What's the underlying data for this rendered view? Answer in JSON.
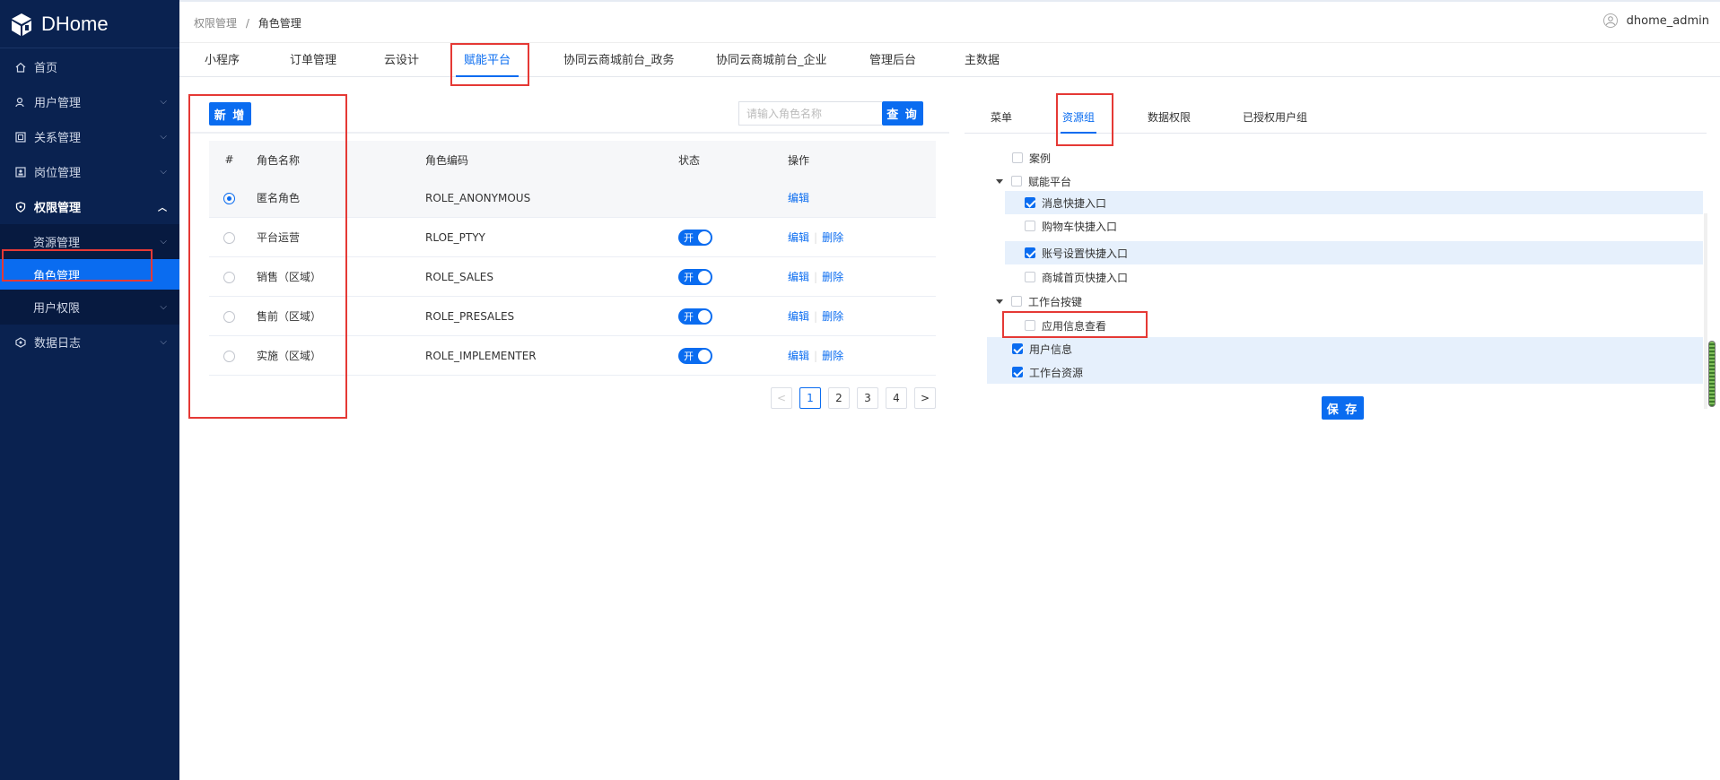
{
  "app": {
    "name": "DHome"
  },
  "sidebar": {
    "items": [
      {
        "label": "首页",
        "icon": "home-icon"
      },
      {
        "label": "用户管理",
        "icon": "user-icon"
      },
      {
        "label": "关系管理",
        "icon": "relation-icon"
      },
      {
        "label": "岗位管理",
        "icon": "post-icon"
      },
      {
        "label": "权限管理",
        "icon": "shield-icon"
      },
      {
        "label": "数据日志",
        "icon": "log-icon"
      }
    ],
    "sub": [
      {
        "label": "资源管理"
      },
      {
        "label": "角色管理"
      },
      {
        "label": "用户权限"
      }
    ]
  },
  "breadcrumb": {
    "parent": "权限管理",
    "sep": "/",
    "current": "角色管理"
  },
  "user": {
    "name": "dhome_admin"
  },
  "tabs": [
    "小程序",
    "订单管理",
    "云设计",
    "赋能平台",
    "协同云商城前台_政务",
    "协同云商城前台_企业",
    "管理后台",
    "主数据"
  ],
  "toolbar": {
    "add_label": "新 增",
    "search_placeholder": "请输入角色名称",
    "search_label": "查 询"
  },
  "table": {
    "headers": [
      "#",
      "角色名称",
      "角色编码",
      "状态",
      "操作"
    ],
    "rows": [
      {
        "name": "匿名角色",
        "code": "ROLE_ANONYMOUS",
        "selected": true,
        "status": "",
        "actions": [
          "编辑"
        ]
      },
      {
        "name": "平台运营",
        "code": "RLOE_PTYY",
        "selected": false,
        "status": "开",
        "actions": [
          "编辑",
          "删除"
        ]
      },
      {
        "name": "销售（区域）",
        "code": "ROLE_SALES",
        "selected": false,
        "status": "开",
        "actions": [
          "编辑",
          "删除"
        ]
      },
      {
        "name": "售前（区域）",
        "code": "ROLE_PRESALES",
        "selected": false,
        "status": "开",
        "actions": [
          "编辑",
          "删除"
        ]
      },
      {
        "name": "实施（区域）",
        "code": "ROLE_IMPLEMENTER",
        "selected": false,
        "status": "开",
        "actions": [
          "编辑",
          "删除"
        ]
      }
    ]
  },
  "pagination": {
    "prev": "<",
    "pages": [
      "1",
      "2",
      "3",
      "4"
    ],
    "current": "1",
    "next": ">"
  },
  "right_tabs": [
    "菜单",
    "资源组",
    "数据权限",
    "已授权用户组"
  ],
  "tree": [
    {
      "label": "案例",
      "checked": false
    },
    {
      "label": "赋能平台",
      "checked": false,
      "expanded": true
    },
    {
      "label": "消息快捷入口",
      "checked": true
    },
    {
      "label": "购物车快捷入口",
      "checked": false
    },
    {
      "label": "账号设置快捷入口",
      "checked": true
    },
    {
      "label": "商城首页快捷入口",
      "checked": false
    },
    {
      "label": "工作台按键",
      "checked": false,
      "expanded": true
    },
    {
      "label": "应用信息查看",
      "checked": false
    },
    {
      "label": "用户信息",
      "checked": true
    },
    {
      "label": "工作台资源",
      "checked": true
    }
  ],
  "save_label": "保 存",
  "colors": {
    "sidebar_bg": "#0a2250",
    "accent": "#0a6cf0",
    "highlight_box": "#e53935"
  }
}
